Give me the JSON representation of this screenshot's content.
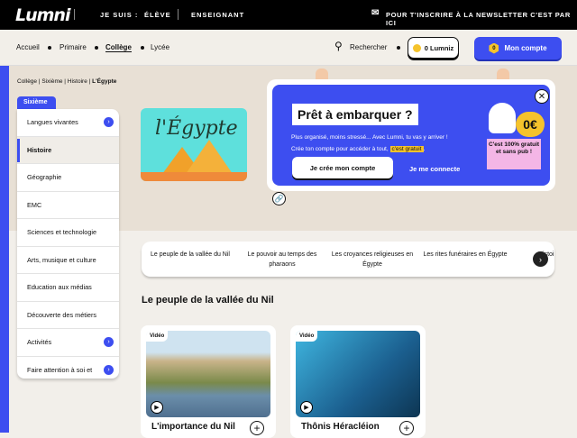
{
  "topbar": {
    "logo": "Lumni",
    "je_suis": "JE SUIS :",
    "eleve": "ÉLÈVE",
    "enseignant": "ENSEIGNANT",
    "newsletter": "POUR T'INSCRIRE À LA NEWSLETTER C'EST PAR ICI"
  },
  "nav": {
    "items": [
      "Accueil",
      "Primaire",
      "Collège",
      "Lycée"
    ],
    "active": "Collège",
    "search": "Rechercher",
    "lumniz": "0 Lumniz",
    "account": "Mon compte",
    "account_badge": "0"
  },
  "breadcrumb": [
    "Collège",
    "Sixième",
    "Histoire",
    "L'Égypte"
  ],
  "sidebar": {
    "tab": "Sixième",
    "items": [
      "Langues vivantes",
      "Histoire",
      "Géographie",
      "EMC",
      "Sciences et technologie",
      "Arts, musique et culture",
      "Education aux médias",
      "Découverte des métiers",
      "Activités",
      "Faire attention à soi et"
    ]
  },
  "hero": {
    "image_title": "l'Égypte"
  },
  "popup": {
    "title": "Prêt à embarquer ?",
    "line1": "Plus organisé, moins stressé... Avec Lumni, tu vas y arriver !",
    "line2": "Crée ton compte pour accéder à tout,",
    "highlight": "c'est gratuit",
    "line2_end": ".",
    "create": "Je crée mon compte",
    "connect": "Je me connecte",
    "price": "0€",
    "promo": "C'est 100% gratuit et sans pub !"
  },
  "chips": [
    "Le peuple de la vallée du Nil",
    "Le pouvoir au temps des pharaons",
    "Les croyances religieuses en Égypte",
    "Les rites funéraires en Égypte",
    "Histoire de l'Égypte"
  ],
  "section_title": "Le peuple de la vallée du Nil",
  "cards": [
    {
      "badge": "Vidéo",
      "title": "L'importance du Nil"
    },
    {
      "badge": "Vidéo",
      "title": "Thônis Héracléion"
    }
  ],
  "colors": {
    "accent": "#3d4ef0",
    "yellow": "#f5c32c"
  }
}
